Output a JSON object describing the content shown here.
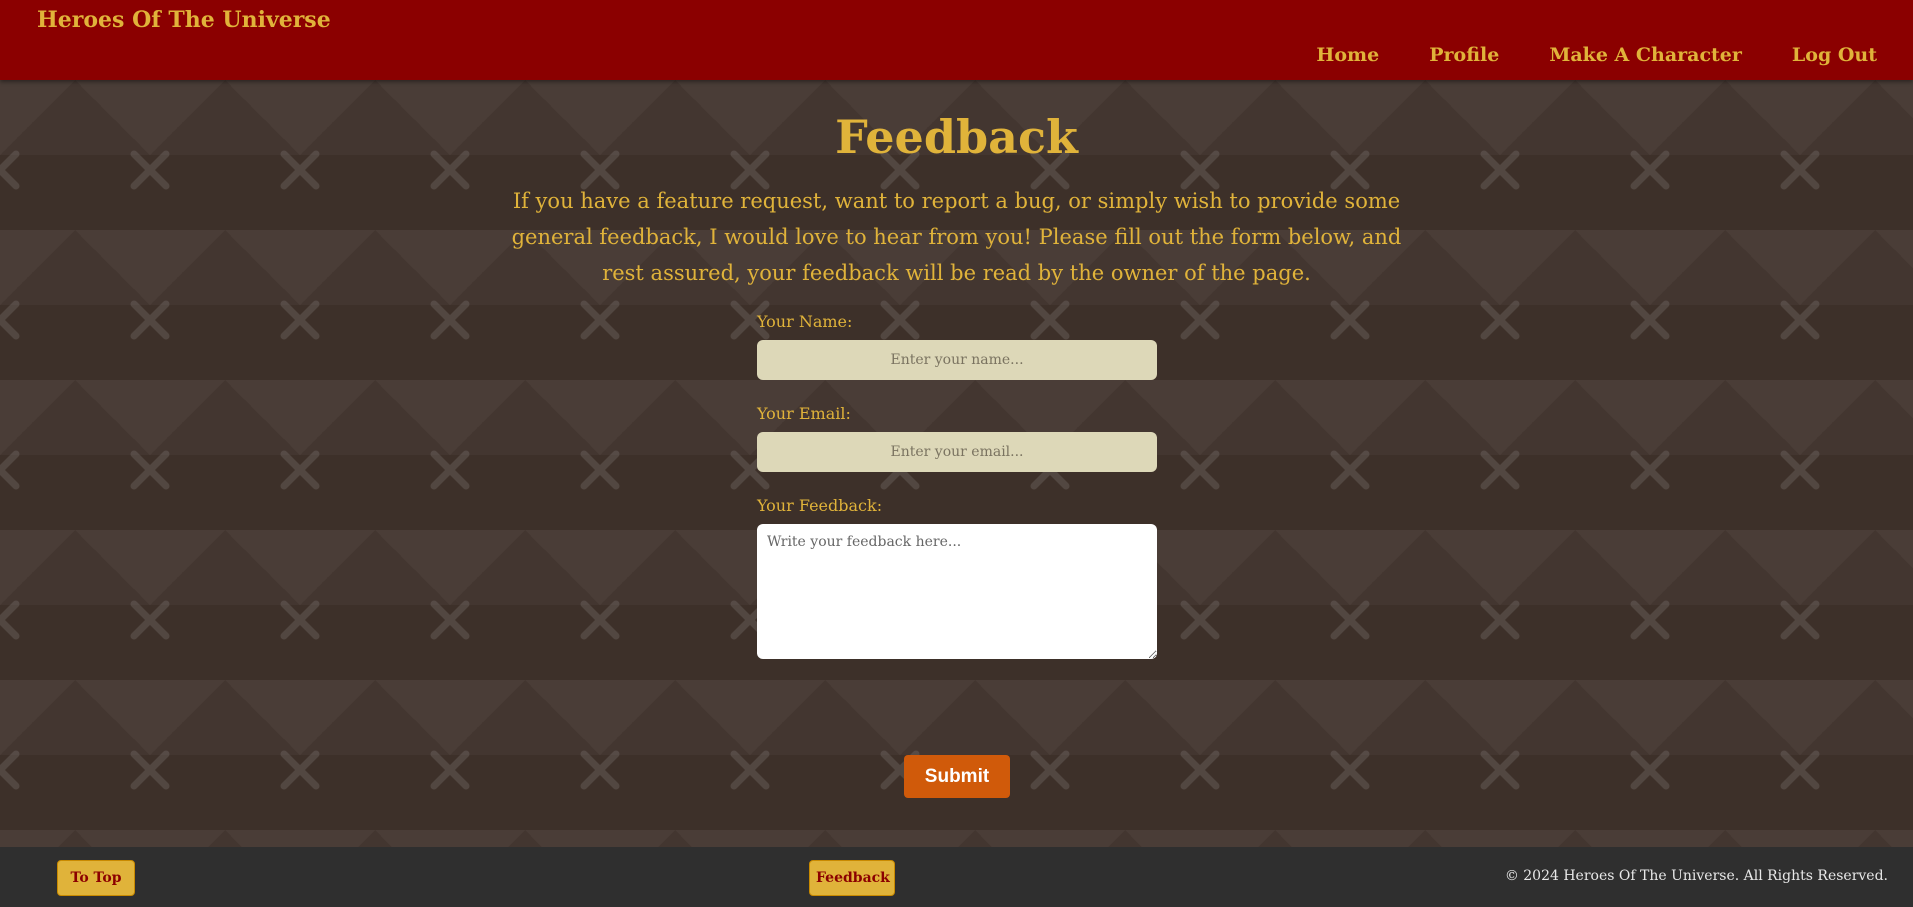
{
  "header": {
    "brand": "Heroes Of The Universe",
    "nav": [
      {
        "label": "Home"
      },
      {
        "label": "Profile"
      },
      {
        "label": "Make A Character"
      },
      {
        "label": "Log Out"
      }
    ]
  },
  "main": {
    "title": "Feedback",
    "intro": "If you have a feature request, want to report a bug, or simply wish to provide some general feedback, I would love to hear from you! Please fill out the form below, and rest assured, your feedback will be read by the owner of the page.",
    "form": {
      "name_label": "Your Name:",
      "name_placeholder": "Enter your name...",
      "email_label": "Your Email:",
      "email_placeholder": "Enter your email...",
      "feedback_label": "Your Feedback:",
      "feedback_placeholder": "Write your feedback here...",
      "submit_label": "Submit"
    }
  },
  "footer": {
    "to_top_label": "To Top",
    "feedback_label": "Feedback",
    "copyright": "© 2024 Heroes Of The Universe. All Rights Reserved."
  },
  "colors": {
    "header_bg": "#8b0000",
    "accent_gold": "#e0b33a",
    "submit_orange": "#d05a0a",
    "footer_bg": "#2f2f2f",
    "background": "#3d3029"
  },
  "background_icon": "crossed-swords-icon"
}
